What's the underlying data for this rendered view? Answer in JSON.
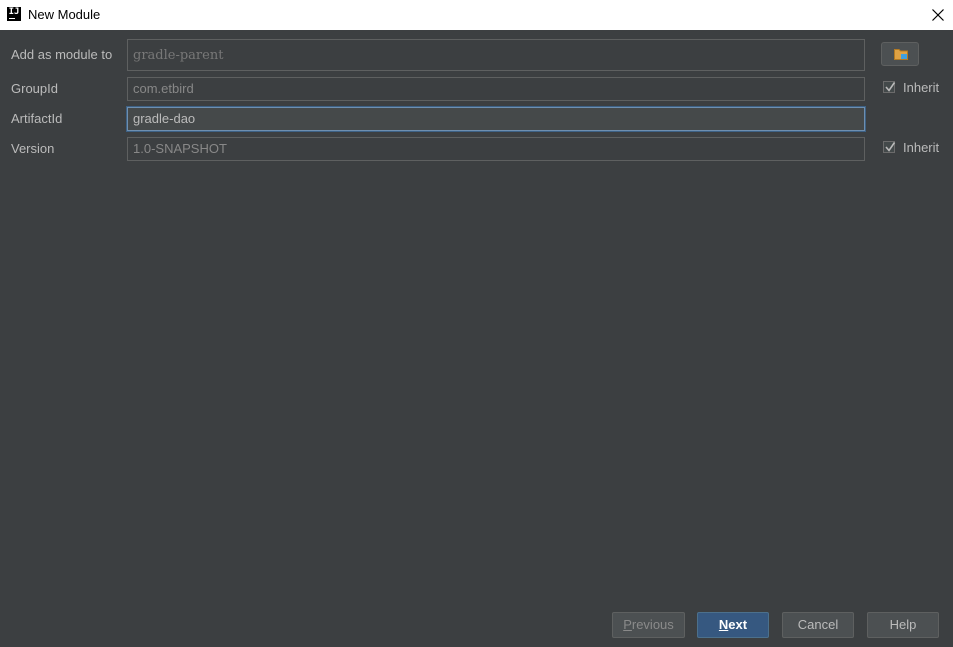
{
  "window": {
    "icon_text": "IJ",
    "title": "New Module"
  },
  "icons": {
    "app": "intellij-icon",
    "close": "close-icon",
    "folder": "folder-icon",
    "check": "checkmark-icon"
  },
  "form": {
    "module_parent": {
      "label": "Add as module to",
      "value": "gradle-parent"
    },
    "group_id": {
      "label": "GroupId",
      "value": "com.etbird",
      "inherit_label": "Inherit",
      "inherit_checked": true
    },
    "artifact_id": {
      "label": "ArtifactId",
      "value": "gradle-dao"
    },
    "version": {
      "label": "Version",
      "value": "1.0-SNAPSHOT",
      "inherit_label": "Inherit",
      "inherit_checked": true
    }
  },
  "buttons": {
    "previous": {
      "mnemonic": "P",
      "rest": "revious"
    },
    "next": {
      "mnemonic": "N",
      "rest": "ext"
    },
    "cancel": "Cancel",
    "help": "Help"
  },
  "colors": {
    "background": "#3c3f41",
    "default_button": "#365880",
    "focus_border": "#6e8fb0"
  }
}
